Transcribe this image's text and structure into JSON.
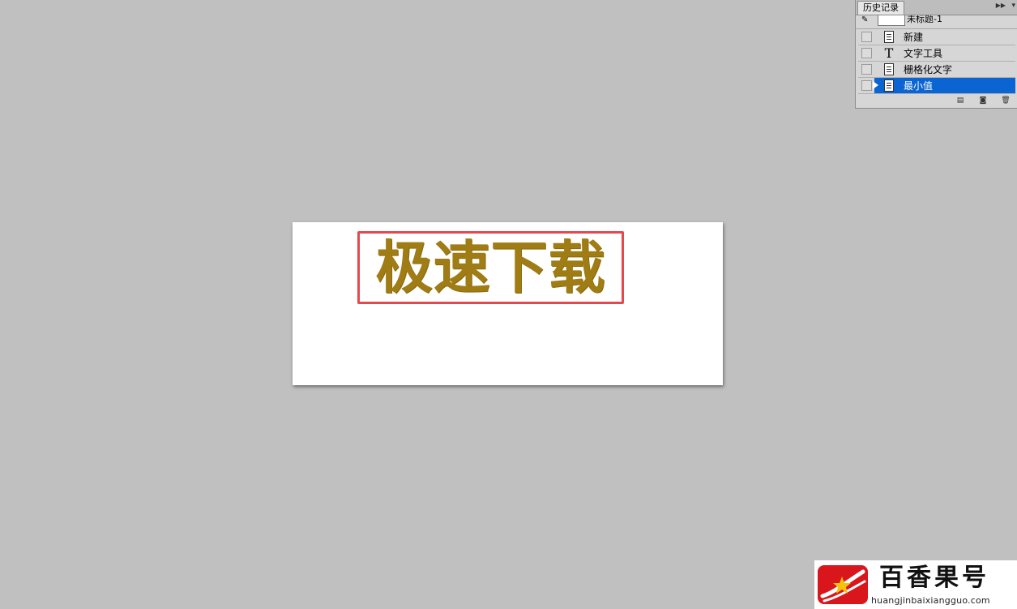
{
  "canvas": {
    "text": "极速下载",
    "text_color": "#a07c14",
    "highlight_color": "#e5484d"
  },
  "history_panel": {
    "tab_label": "历史记录",
    "menu_icon": "double-arrow-icon",
    "snapshot_label": "未标题-1",
    "items": [
      {
        "label": "新建",
        "icon": "document-icon",
        "selected": false
      },
      {
        "label": "文字工具",
        "icon": "type-tool-icon",
        "icon_glyph": "T",
        "selected": false
      },
      {
        "label": "栅格化文字",
        "icon": "document-icon",
        "selected": false
      },
      {
        "label": "最小值",
        "icon": "document-icon",
        "selected": true
      }
    ],
    "selection_color": "#0a64d2"
  },
  "watermark": {
    "title": "百香果号",
    "url": "huangjinbaixiangguo.com",
    "logo_color": "#d9161c"
  }
}
